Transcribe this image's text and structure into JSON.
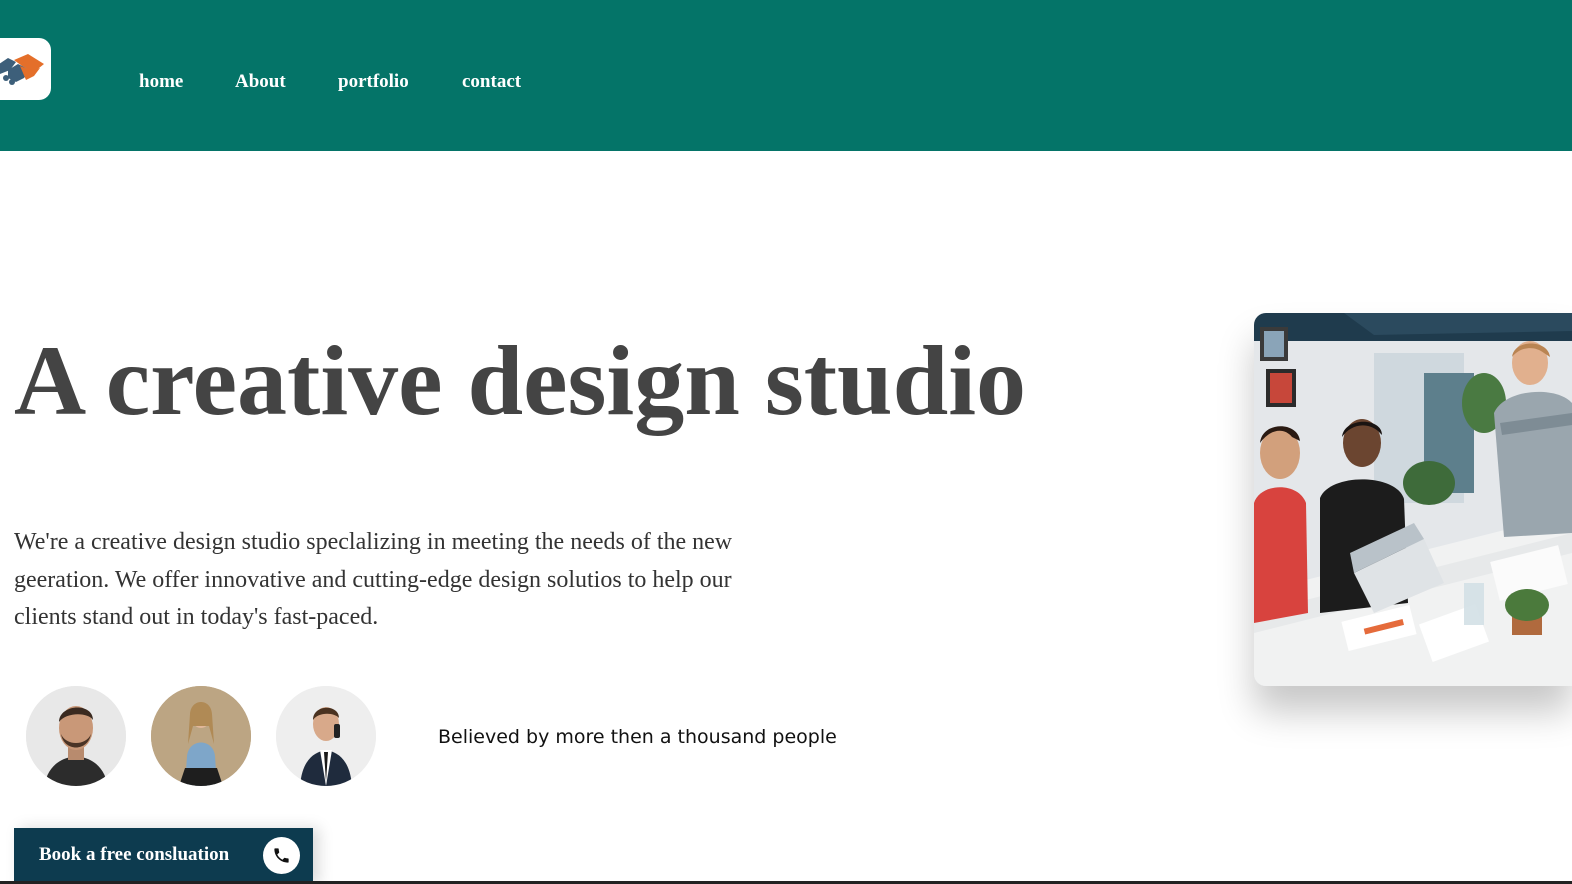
{
  "header": {
    "background": "#047468",
    "logo_icon": "handshake-icon",
    "nav": [
      {
        "label": "home"
      },
      {
        "label": "About"
      },
      {
        "label": "portfolio"
      },
      {
        "label": "contact"
      }
    ]
  },
  "hero": {
    "title": "A creative design studio",
    "description": "We're a creative design studio speclalizing in meeting the needs of the new geeration. We offer innovative and cutting-edge design solutios to help our clients stand out in today's fast-paced.",
    "social_proof": "Believed by more then a thousand people",
    "avatars": [
      "avatar-man-beard",
      "avatar-woman-denim",
      "avatar-man-suit-phone"
    ],
    "image": "team-meeting-photo"
  },
  "cta": {
    "label": "Book a free consluation",
    "icon": "phone-icon",
    "background": "#0d3b4f"
  }
}
